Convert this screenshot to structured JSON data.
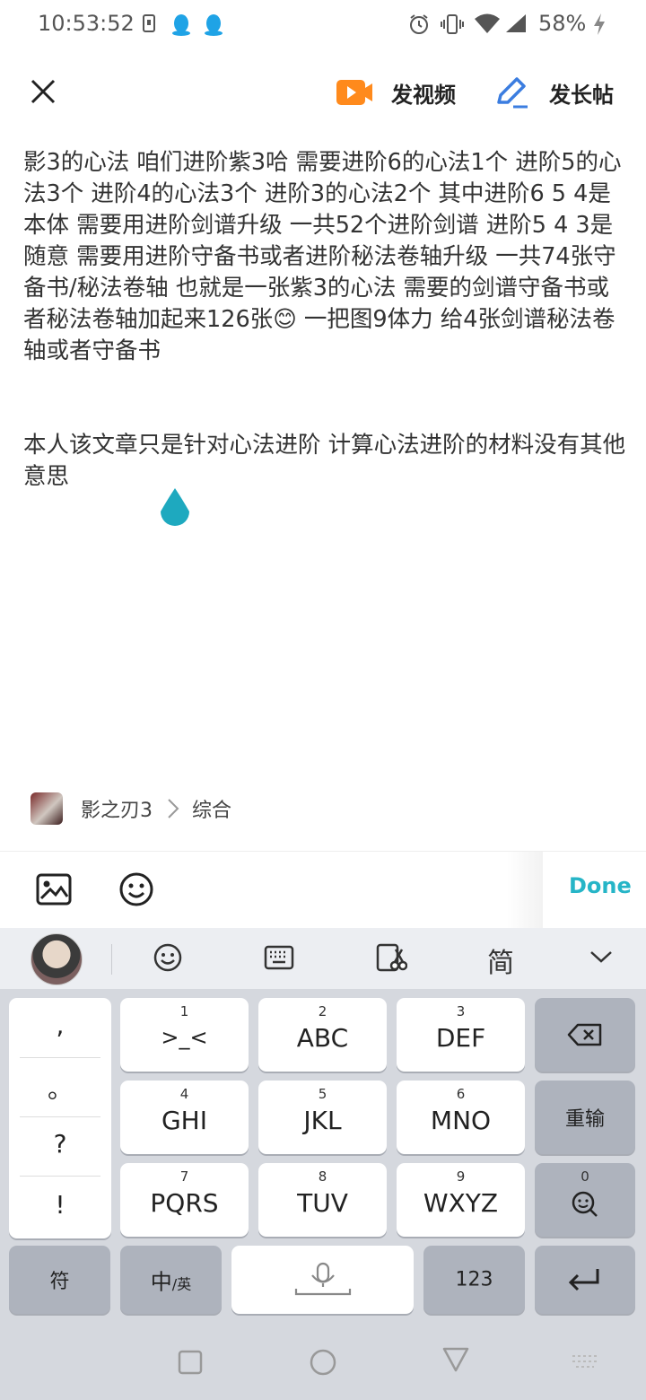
{
  "status_bar": {
    "time": "10:53:52",
    "battery": "58%"
  },
  "header": {
    "video_label": "发视频",
    "long_post_label": "发长帖",
    "video_icon_color": "#ff8a1c",
    "pen_icon_color": "#3b7de0"
  },
  "article": {
    "paragraph1": "影3的心法 咱们进阶紫3哈 需要进阶6的心法1个   进阶5的心法3个  进阶4的心法3个  进阶3的心法2个  其中进阶6 5 4是本体 需要用进阶剑谱升级  一共52个进阶剑谱    进阶5 4 3是随意 需要用进阶守备书或者进阶秘法卷轴升级  一共74张守备书/秘法卷轴   也就是一张紫3的心法  需要的剑谱守备书或者秘法卷轴加起来126张",
    "emoji": "😊",
    "paragraph1_end": " 一把图9体力  给4张剑谱秘法卷轴或者守备书",
    "paragraph2": "本人该文章只是针对心法进阶  计算心法进阶的材料没有其他意思"
  },
  "category": {
    "game": "影之刃3",
    "section": "综合"
  },
  "editor_toolbar": {
    "done_label": "Done",
    "accent": "#26b5c7"
  },
  "keyboard": {
    "simplified_label": "简",
    "punctuation": [
      ",",
      "。",
      "?",
      "!"
    ],
    "keys": [
      {
        "num": "1",
        "label": ">_<"
      },
      {
        "num": "2",
        "label": "ABC"
      },
      {
        "num": "3",
        "label": "DEF"
      },
      {
        "num": "4",
        "label": "GHI"
      },
      {
        "num": "5",
        "label": "JKL"
      },
      {
        "num": "6",
        "label": "MNO"
      },
      {
        "num": "7",
        "label": "PQRS"
      },
      {
        "num": "8",
        "label": "TUV"
      },
      {
        "num": "9",
        "label": "WXYZ"
      }
    ],
    "retype_label": "重输",
    "zero_label": "0",
    "symbol_label": "符",
    "lang_label_main": "中",
    "lang_label_sub": "/英",
    "numbers_label": "123"
  }
}
